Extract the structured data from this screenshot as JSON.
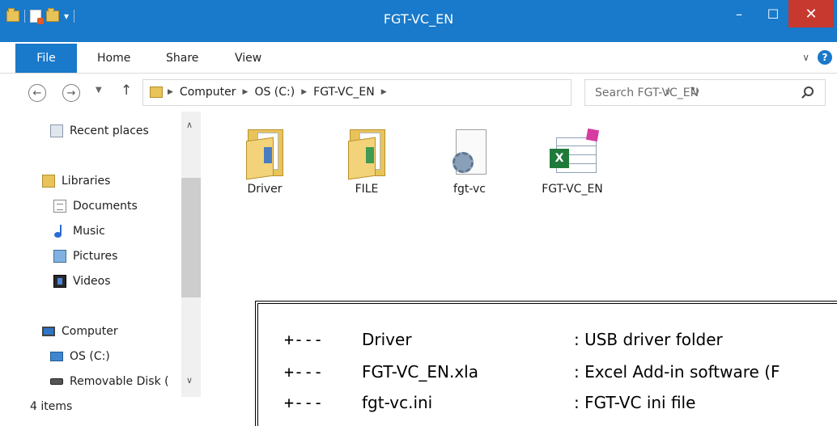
{
  "window": {
    "title": "FGT-VC_EN",
    "minimize": "–",
    "maximize": "☐",
    "close": "✕"
  },
  "ribbon": {
    "tabs": [
      "File",
      "Home",
      "Share",
      "View"
    ],
    "help": "?"
  },
  "address": {
    "crumbs": [
      "Computer",
      "OS (C:)",
      "FGT-VC_EN"
    ],
    "search_placeholder": "Search FGT-VC_EN"
  },
  "navpane": {
    "items": [
      "Recent places",
      "Libraries",
      "Documents",
      "Music",
      "Pictures",
      "Videos",
      "Computer",
      "OS (C:)",
      "Removable Disk ("
    ]
  },
  "status": {
    "items": "4 items"
  },
  "files": [
    {
      "name": "Driver",
      "type": "folder"
    },
    {
      "name": "FILE",
      "type": "folder"
    },
    {
      "name": "fgt-vc",
      "type": "ini"
    },
    {
      "name": "FGT-VC_EN",
      "type": "xla"
    }
  ],
  "overlay": {
    "rows": [
      {
        "prefix": "+---",
        "name": "Driver",
        "desc": ": USB driver folder"
      },
      {
        "prefix": "+---",
        "name": "FGT-VC_EN.xla",
        "desc": ": Excel Add-in software (F"
      },
      {
        "prefix": "+---",
        "name": "fgt-vc.ini",
        "desc": ": FGT-VC ini file"
      }
    ]
  },
  "colors": {
    "accent": "#1979ca",
    "close": "#c7382f"
  }
}
